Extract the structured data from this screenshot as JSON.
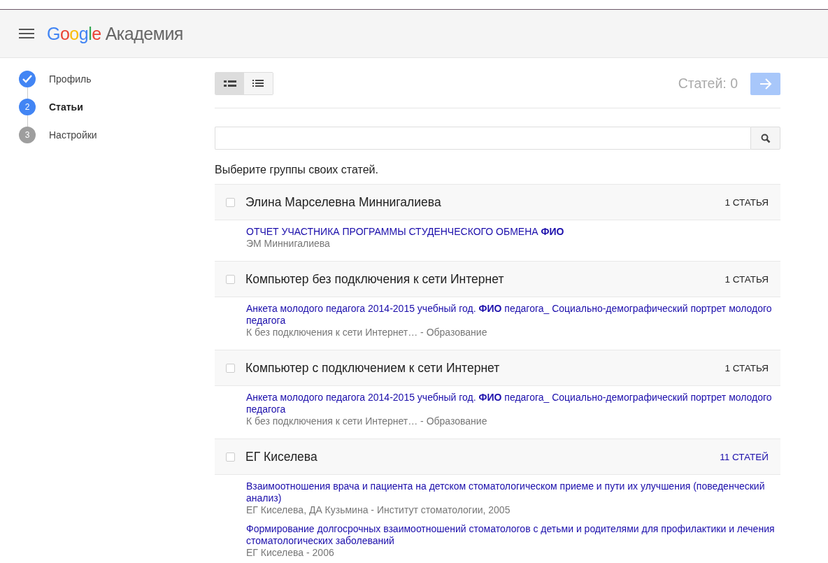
{
  "header": {
    "logo": "Google",
    "product": "Академия"
  },
  "steps": [
    {
      "label": "Профиль",
      "completed": true,
      "selected": false
    },
    {
      "label": "Статьи",
      "number": "2",
      "completed": false,
      "selected": true
    },
    {
      "label": "Настройки",
      "number": "3",
      "completed": false,
      "selected": false
    }
  ],
  "view_modes": [
    {
      "selected": true
    },
    {
      "selected": false
    }
  ],
  "article_count": "Статей: 0",
  "next_disabled": true,
  "prompt": "Выберите группы своих статей.",
  "groups": [
    {
      "name": "Элина Марселевна Миннигалиева",
      "count": "1 СТАТЬЯ",
      "count_link": false,
      "checked": false,
      "articles": [
        {
          "title": "ОТЧЕТ УЧАСТНИКА ПРОГРАММЫ СТУДЕНЧЕСКОГО ОБМЕНА **ФИО**",
          "meta": "ЭМ Миннигалиева"
        }
      ]
    },
    {
      "name": "Компьютер без подключения к сети Интернет",
      "count": "1 СТАТЬЯ",
      "count_link": false,
      "checked": false,
      "articles": [
        {
          "title": "Анкета молодого педагога 2014-2015 учебный год. **ФИО** педагога_ Социально-демографический портрет молодого педагога",
          "meta": "К без подключения к сети Интернет… - Образование"
        }
      ]
    },
    {
      "name": "Компьютер с подключением к сети Интернет",
      "count": "1 СТАТЬЯ",
      "count_link": false,
      "checked": false,
      "articles": [
        {
          "title": "Анкета молодого педагога 2014-2015 учебный год. **ФИО** педагога_ Социально-демографический портрет молодого педагога",
          "meta": "К без подключения к сети Интернет… - Образование"
        }
      ]
    },
    {
      "name": "ЕГ Киселева",
      "count": "11 СТАТЕЙ",
      "count_link": true,
      "checked": false,
      "articles": [
        {
          "title": "Взаимоотношения врача и пациента на детском стоматологическом приеме и пути их улучшения (поведенческий анализ)",
          "meta": "ЕГ Киселева, ДА Кузьмина - Институт стоматологии, 2005"
        },
        {
          "title": "Формирование долгосрочных взаимоотношений стоматологов с детьми и родителями для профилактики и лечения стоматологических заболеваний",
          "meta": "ЕГ Киселева - 2006"
        }
      ]
    }
  ]
}
